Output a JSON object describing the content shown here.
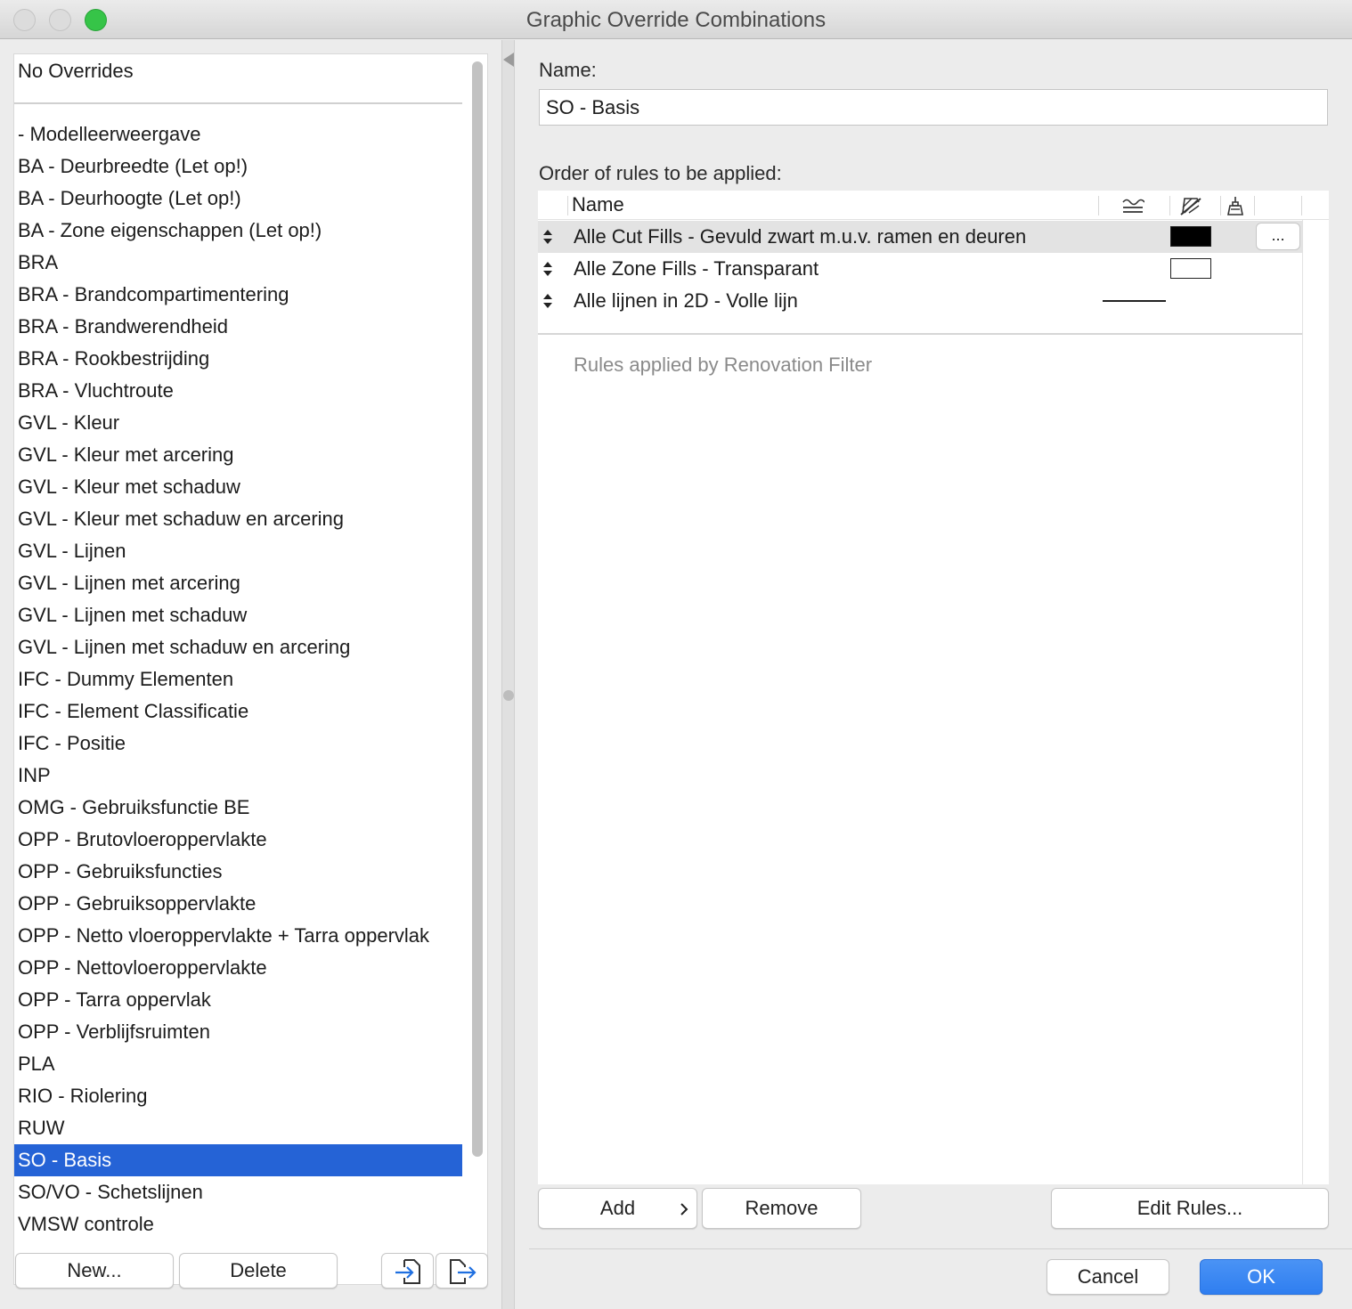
{
  "window": {
    "title": "Graphic Override Combinations"
  },
  "left": {
    "no_overrides": "No Overrides",
    "items": [
      "- Modelleerweergave",
      "BA - Deurbreedte (Let op!)",
      "BA - Deurhoogte (Let op!)",
      "BA - Zone eigenschappen (Let op!)",
      "BRA",
      "BRA - Brandcompartimentering",
      "BRA - Brandwerendheid",
      "BRA - Rookbestrijding",
      "BRA - Vluchtroute",
      "GVL - Kleur",
      "GVL - Kleur met arcering",
      "GVL - Kleur met schaduw",
      "GVL - Kleur met schaduw en arcering",
      "GVL - Lijnen",
      "GVL - Lijnen met arcering",
      "GVL - Lijnen met schaduw",
      "GVL - Lijnen met schaduw en arcering",
      "IFC - Dummy Elementen",
      "IFC - Element Classificatie",
      "IFC - Positie",
      "INP",
      "OMG - Gebruiksfunctie BE",
      "OPP - Brutovloeroppervlakte",
      "OPP - Gebruiksfuncties",
      "OPP - Gebruiksoppervlakte",
      "OPP - Netto vloeroppervlakte + Tarra oppervlak",
      "OPP - Nettovloeroppervlakte",
      "OPP - Tarra oppervlak",
      "OPP - Verblijfsruimten",
      "PLA",
      "RIO - Riolering",
      "RUW",
      "SO - Basis",
      "SO/VO - Schetslijnen",
      "VMSW controle"
    ],
    "selected_item": "SO - Basis",
    "new_label": "New...",
    "delete_label": "Delete"
  },
  "right": {
    "name_label": "Name:",
    "name_value": "SO - Basis",
    "order_label": "Order of rules to be applied:",
    "col_name": "Name",
    "rules": [
      {
        "name": "Alle Cut Fills - Gevuld zwart m.u.v. ramen en deuren",
        "fill": "#000000",
        "highlighted": true,
        "more": "..."
      },
      {
        "name": "Alle Zone Fills - Transparant",
        "fill": "transparent",
        "highlighted": false
      },
      {
        "name": "Alle lijnen in 2D - Volle lijn",
        "line": true,
        "highlighted": false
      }
    ],
    "renovation_label": "Rules applied by Renovation Filter",
    "add_label": "Add",
    "remove_label": "Remove",
    "edit_rules_label": "Edit Rules...",
    "cancel_label": "Cancel",
    "ok_label": "OK"
  },
  "colors": {
    "selection": "#2563d6",
    "ok_button": "#2f7ef0",
    "zoom_button": "#36c448"
  }
}
